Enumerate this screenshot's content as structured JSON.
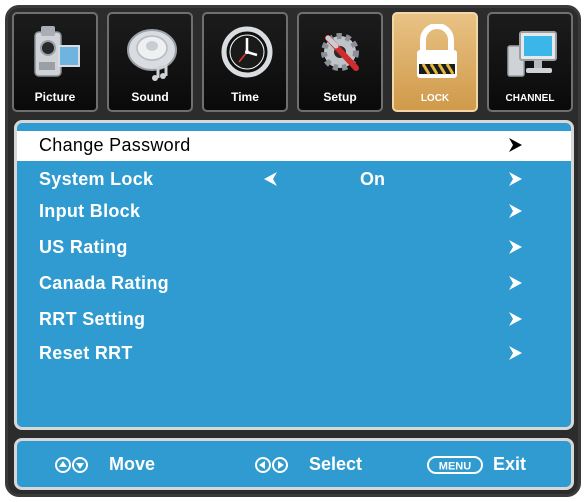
{
  "tabs": [
    {
      "label": "Picture",
      "icon": "camcorder-icon"
    },
    {
      "label": "Sound",
      "icon": "speaker-icon"
    },
    {
      "label": "Time",
      "icon": "clock-icon"
    },
    {
      "label": "Setup",
      "icon": "settings-tools-icon"
    },
    {
      "label": "LOCK",
      "icon": "padlock-icon",
      "active": true
    },
    {
      "label": "CHANNEL",
      "icon": "computer-monitor-icon"
    }
  ],
  "menu": {
    "items": [
      {
        "label": "Change Password",
        "selected": true
      },
      {
        "label": "System Lock",
        "value": "On"
      },
      {
        "label": "Input Block"
      },
      {
        "label": "US Rating"
      },
      {
        "label": "Canada Rating"
      },
      {
        "label": "RRT Setting"
      },
      {
        "label": "Reset RRT"
      }
    ]
  },
  "footer": {
    "move_label": "Move",
    "select_label": "Select",
    "menu_key_label": "MENU",
    "exit_label": "Exit"
  },
  "colors": {
    "panel_blue": "#2f9bd0",
    "active_tab": "#dcaa62",
    "frame": "#2c2c2c"
  }
}
